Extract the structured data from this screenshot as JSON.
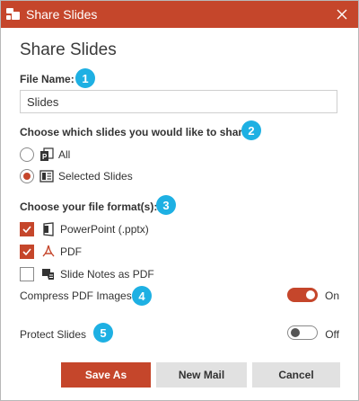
{
  "window": {
    "title": "Share Slides"
  },
  "dialog": {
    "heading": "Share Slides",
    "file_name": {
      "label": "File Name:",
      "badge": "1",
      "value": "Slides"
    },
    "slides_choice": {
      "label": "Choose which slides you would like to share:",
      "badge": "2",
      "options": [
        {
          "label": "All",
          "checked": false
        },
        {
          "label": "Selected Slides",
          "checked": true
        }
      ]
    },
    "formats": {
      "label": "Choose your file format(s):",
      "badge": "3",
      "items": [
        {
          "label": "PowerPoint (.pptx)",
          "checked": true,
          "icon": "powerpoint-icon"
        },
        {
          "label": "PDF",
          "checked": true,
          "icon": "pdf-icon"
        },
        {
          "label": "Slide Notes as PDF",
          "checked": false,
          "icon": "slide-notes-icon"
        }
      ]
    },
    "compress": {
      "label": "Compress PDF Images",
      "badge": "4",
      "state": "On",
      "on": true
    },
    "protect": {
      "label": "Protect Slides",
      "badge": "5",
      "state": "Off",
      "on": false
    },
    "buttons": {
      "save_as": "Save As",
      "new_mail": "New Mail",
      "cancel": "Cancel"
    }
  },
  "colors": {
    "accent": "#c5462b",
    "badge": "#1eb0e3",
    "secondary_button": "#e1e1e1"
  }
}
